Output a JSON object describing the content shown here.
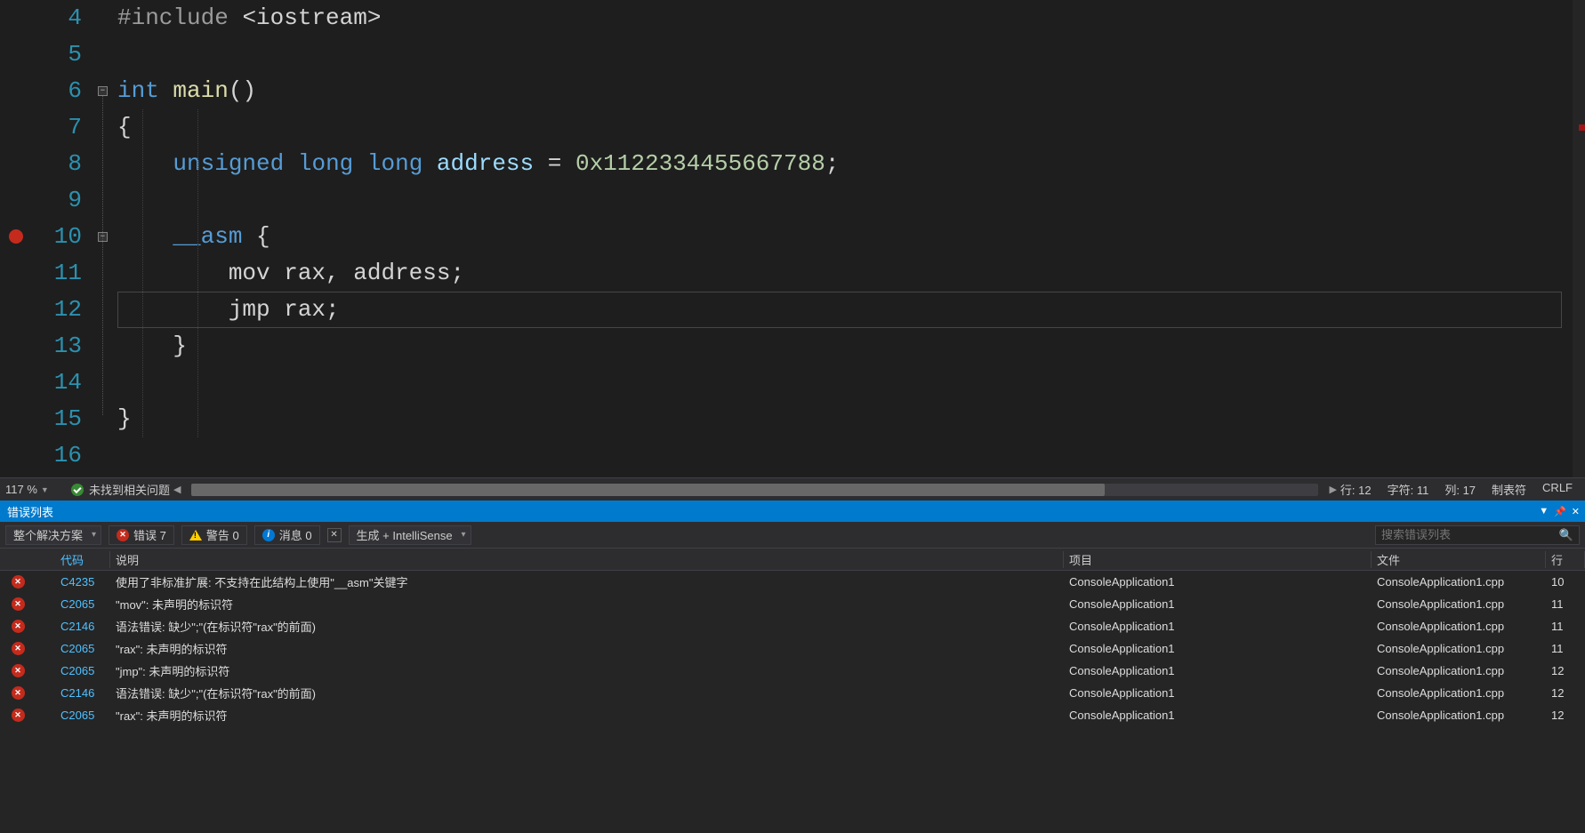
{
  "editor": {
    "first_line_number": 4,
    "breakpoint_line": 10,
    "current_line": 12,
    "lines": [
      {
        "n": 4,
        "tokens": [
          {
            "cls": "tok-pp",
            "t": "#include "
          },
          {
            "cls": "tok-punct",
            "t": "<"
          },
          {
            "cls": "tok-plain",
            "t": "iostream"
          },
          {
            "cls": "tok-punct",
            "t": ">"
          }
        ]
      },
      {
        "n": 5,
        "tokens": []
      },
      {
        "n": 6,
        "fold": "open",
        "tokens": [
          {
            "cls": "tok-kw",
            "t": "int"
          },
          {
            "cls": "tok-plain",
            "t": " "
          },
          {
            "cls": "tok-ident",
            "t": "main"
          },
          {
            "cls": "tok-punct",
            "t": "()"
          }
        ]
      },
      {
        "n": 7,
        "tokens": [
          {
            "cls": "tok-punct",
            "t": "{"
          }
        ]
      },
      {
        "n": 8,
        "tokens": [
          {
            "cls": "tok-plain",
            "t": "    "
          },
          {
            "cls": "tok-kw",
            "t": "unsigned"
          },
          {
            "cls": "tok-plain",
            "t": " "
          },
          {
            "cls": "tok-kw",
            "t": "long"
          },
          {
            "cls": "tok-plain",
            "t": " "
          },
          {
            "cls": "tok-kw",
            "t": "long"
          },
          {
            "cls": "tok-plain",
            "t": " "
          },
          {
            "cls": "tok-var",
            "t": "address"
          },
          {
            "cls": "tok-plain",
            "t": " "
          },
          {
            "cls": "tok-punct",
            "t": "="
          },
          {
            "cls": "tok-plain",
            "t": " "
          },
          {
            "cls": "tok-num",
            "t": "0x1122334455667788"
          },
          {
            "cls": "tok-punct",
            "t": ";"
          }
        ]
      },
      {
        "n": 9,
        "tokens": []
      },
      {
        "n": 10,
        "fold": "open",
        "tokens": [
          {
            "cls": "tok-plain",
            "t": "    "
          },
          {
            "cls": "tok-kw",
            "t": "__asm"
          },
          {
            "cls": "tok-plain",
            "t": " "
          },
          {
            "cls": "tok-punct",
            "t": "{"
          }
        ]
      },
      {
        "n": 11,
        "tokens": [
          {
            "cls": "tok-plain",
            "t": "        mov rax, address;"
          }
        ]
      },
      {
        "n": 12,
        "tokens": [
          {
            "cls": "tok-plain",
            "t": "        jmp rax;"
          }
        ]
      },
      {
        "n": 13,
        "tokens": [
          {
            "cls": "tok-plain",
            "t": "    "
          },
          {
            "cls": "tok-punct",
            "t": "}"
          }
        ]
      },
      {
        "n": 14,
        "tokens": []
      },
      {
        "n": 15,
        "tokens": [
          {
            "cls": "tok-punct",
            "t": "}"
          }
        ]
      },
      {
        "n": 16,
        "tokens": []
      }
    ]
  },
  "status": {
    "zoom": "117 %",
    "issues_text": "未找到相关问题",
    "line_label": "行: 12",
    "char_label": "字符: 11",
    "col_label": "列: 17",
    "tab_label": "制表符",
    "eol_label": "CRLF"
  },
  "panel": {
    "title": "错误列表",
    "scope": "整个解决方案",
    "errors_label": "错误 7",
    "warnings_label": "警告 0",
    "messages_label": "消息 0",
    "filter_source": "生成 + IntelliSense",
    "search_placeholder": "搜索错误列表"
  },
  "table": {
    "headers": {
      "code": "代码",
      "desc": "说明",
      "proj": "项目",
      "file": "文件",
      "line": "行"
    },
    "rows": [
      {
        "code": "C4235",
        "desc": "使用了非标准扩展: 不支持在此结构上使用\"__asm\"关键字",
        "proj": "ConsoleApplication1",
        "file": "ConsoleApplication1.cpp",
        "line": "10"
      },
      {
        "code": "C2065",
        "desc": "\"mov\": 未声明的标识符",
        "proj": "ConsoleApplication1",
        "file": "ConsoleApplication1.cpp",
        "line": "11"
      },
      {
        "code": "C2146",
        "desc": "语法错误: 缺少\";\"(在标识符\"rax\"的前面)",
        "proj": "ConsoleApplication1",
        "file": "ConsoleApplication1.cpp",
        "line": "11"
      },
      {
        "code": "C2065",
        "desc": "\"rax\": 未声明的标识符",
        "proj": "ConsoleApplication1",
        "file": "ConsoleApplication1.cpp",
        "line": "11"
      },
      {
        "code": "C2065",
        "desc": "\"jmp\": 未声明的标识符",
        "proj": "ConsoleApplication1",
        "file": "ConsoleApplication1.cpp",
        "line": "12"
      },
      {
        "code": "C2146",
        "desc": "语法错误: 缺少\";\"(在标识符\"rax\"的前面)",
        "proj": "ConsoleApplication1",
        "file": "ConsoleApplication1.cpp",
        "line": "12"
      },
      {
        "code": "C2065",
        "desc": "\"rax\": 未声明的标识符",
        "proj": "ConsoleApplication1",
        "file": "ConsoleApplication1.cpp",
        "line": "12"
      }
    ]
  }
}
